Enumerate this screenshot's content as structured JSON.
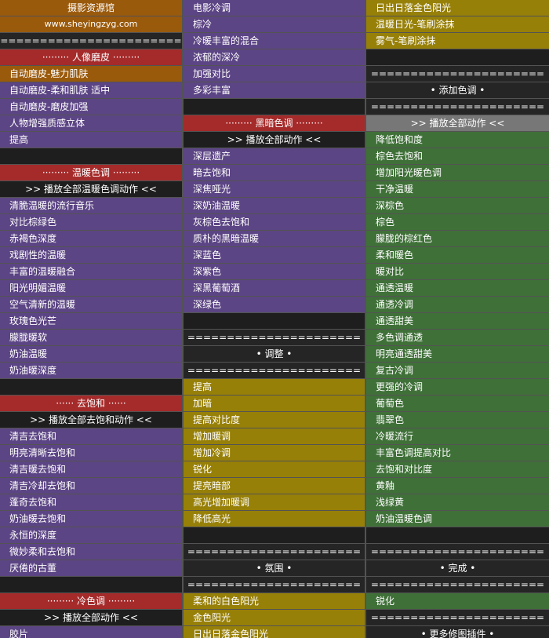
{
  "col1": [
    {
      "text": "摄影资源馆",
      "type": "logo"
    },
    {
      "text": "www.sheyingzyg.com",
      "type": "url"
    },
    {
      "text": "=======================",
      "type": "sep"
    },
    {
      "text": "·········   人像磨皮  ·········",
      "type": "header"
    },
    {
      "text": "自动磨皮-魅力肌肤",
      "type": "orange"
    },
    {
      "text": "自动磨皮-柔和肌肤  适中",
      "type": "purple"
    },
    {
      "text": "自动磨皮-磨皮加强",
      "type": "purple"
    },
    {
      "text": "人物增强质感立体",
      "type": "purple"
    },
    {
      "text": "提高",
      "type": "purple"
    },
    {
      "text": "",
      "type": "black"
    },
    {
      "text": "·········   温暖色调  ·········",
      "type": "header"
    },
    {
      "text": ">> 播放全部温暖色调动作  <<",
      "type": "play"
    },
    {
      "text": "清脆温暖的流行音乐",
      "type": "purple"
    },
    {
      "text": "对比棕绿色",
      "type": "purple"
    },
    {
      "text": "赤褐色深度",
      "type": "purple"
    },
    {
      "text": "戏剧性的温暖",
      "type": "purple"
    },
    {
      "text": "丰富的温暖融合",
      "type": "purple"
    },
    {
      "text": "阳光明媚温暖",
      "type": "purple"
    },
    {
      "text": "空气清新的温暖",
      "type": "purple"
    },
    {
      "text": "玫瑰色光芒",
      "type": "purple"
    },
    {
      "text": "朦胧暖软",
      "type": "purple"
    },
    {
      "text": "奶油温暖",
      "type": "purple"
    },
    {
      "text": "奶油暖深度",
      "type": "purple"
    },
    {
      "text": "",
      "type": "black"
    },
    {
      "text": "······   去饱和   ······",
      "type": "header"
    },
    {
      "text": ">> 播放全部去饱和动作  <<",
      "type": "play"
    },
    {
      "text": "清吉去饱和",
      "type": "purple"
    },
    {
      "text": "明亮清晰去饱和",
      "type": "purple"
    },
    {
      "text": "清吉暖去饱和",
      "type": "purple"
    },
    {
      "text": "清吉冷却去饱和",
      "type": "purple"
    },
    {
      "text": "蓬奇去饱和",
      "type": "purple"
    },
    {
      "text": "奶油暖去饱和",
      "type": "purple"
    },
    {
      "text": "永恒的深度",
      "type": "purple"
    },
    {
      "text": "微妙柔和去饱和",
      "type": "purple"
    },
    {
      "text": "厌倦的古董",
      "type": "purple"
    },
    {
      "text": "",
      "type": "black"
    },
    {
      "text": "·········   冷色调  ·········",
      "type": "header"
    },
    {
      "text": ">> 播放全部动作  <<",
      "type": "play"
    },
    {
      "text": "胶片",
      "type": "purple"
    }
  ],
  "col2": [
    {
      "text": "电影冷调",
      "type": "purple"
    },
    {
      "text": "棕冷",
      "type": "purple"
    },
    {
      "text": "冷暖丰富的混合",
      "type": "purple"
    },
    {
      "text": "浓郁的深冷",
      "type": "purple"
    },
    {
      "text": "加强对比",
      "type": "purple"
    },
    {
      "text": "多彩丰富",
      "type": "purple"
    },
    {
      "text": "",
      "type": "black"
    },
    {
      "text": "·········   黑暗色调  ·········",
      "type": "header"
    },
    {
      "text": ">> 播放全部动作  <<",
      "type": "play"
    },
    {
      "text": "深层遗产",
      "type": "purple"
    },
    {
      "text": "暗去饱和",
      "type": "purple"
    },
    {
      "text": "深焦哑光",
      "type": "purple"
    },
    {
      "text": "深奶油温暖",
      "type": "purple"
    },
    {
      "text": "灰棕色去饱和",
      "type": "purple"
    },
    {
      "text": "质朴的黑暗温暖",
      "type": "purple"
    },
    {
      "text": "深蓝色",
      "type": "purple"
    },
    {
      "text": "深紫色",
      "type": "purple"
    },
    {
      "text": "深黑葡萄酒",
      "type": "purple"
    },
    {
      "text": "深绿色",
      "type": "purple"
    },
    {
      "text": "",
      "type": "black"
    },
    {
      "text": "======================",
      "type": "sep"
    },
    {
      "text": "•  调整  •",
      "type": "sep"
    },
    {
      "text": "======================",
      "type": "sep"
    },
    {
      "text": "提高",
      "type": "gold"
    },
    {
      "text": "加暗",
      "type": "gold"
    },
    {
      "text": "提高对比度",
      "type": "gold"
    },
    {
      "text": "增加暖调",
      "type": "gold"
    },
    {
      "text": "增加冷调",
      "type": "gold"
    },
    {
      "text": "锐化",
      "type": "gold"
    },
    {
      "text": "提亮暗部",
      "type": "gold"
    },
    {
      "text": "高光增加暖调",
      "type": "gold"
    },
    {
      "text": "降低高光",
      "type": "gold"
    },
    {
      "text": "",
      "type": "black"
    },
    {
      "text": "======================",
      "type": "sep"
    },
    {
      "text": "•  氛围  •",
      "type": "sep"
    },
    {
      "text": "======================",
      "type": "sep"
    },
    {
      "text": "柔和的白色阳光",
      "type": "gold"
    },
    {
      "text": "金色阳光",
      "type": "gold"
    },
    {
      "text": "日出日落金色阳光",
      "type": "gold"
    }
  ],
  "col3": [
    {
      "text": "日出日落金色阳光",
      "type": "gold"
    },
    {
      "text": "温暖日光-笔刷涂抹",
      "type": "gold"
    },
    {
      "text": "雾气-笔刷涂抹",
      "type": "gold"
    },
    {
      "text": "",
      "type": "black"
    },
    {
      "text": "======================",
      "type": "sep"
    },
    {
      "text": "•  添加色调  •",
      "type": "sep"
    },
    {
      "text": "======================",
      "type": "sep"
    },
    {
      "text": ">> 播放全部动作  <<",
      "type": "gray"
    },
    {
      "text": "降低饱和度",
      "type": "green"
    },
    {
      "text": "棕色去饱和",
      "type": "green"
    },
    {
      "text": "增加阳光暖色调",
      "type": "green"
    },
    {
      "text": "干净温暖",
      "type": "green"
    },
    {
      "text": "深棕色",
      "type": "green"
    },
    {
      "text": "棕色",
      "type": "green"
    },
    {
      "text": "朦胧的棕红色",
      "type": "green"
    },
    {
      "text": "柔和暖色",
      "type": "green"
    },
    {
      "text": "暖对比",
      "type": "green"
    },
    {
      "text": "通透温暖",
      "type": "green"
    },
    {
      "text": "通透冷调",
      "type": "green"
    },
    {
      "text": "通透甜美",
      "type": "green"
    },
    {
      "text": "多色调通透",
      "type": "green"
    },
    {
      "text": "明亮通透甜美",
      "type": "green"
    },
    {
      "text": "复古冷调",
      "type": "green"
    },
    {
      "text": "更强的冷调",
      "type": "green"
    },
    {
      "text": "葡萄色",
      "type": "green"
    },
    {
      "text": "翡翠色",
      "type": "green"
    },
    {
      "text": "冷暖流行",
      "type": "green"
    },
    {
      "text": "丰富色调提高对比",
      "type": "green"
    },
    {
      "text": "去饱和对比度",
      "type": "green"
    },
    {
      "text": "黄釉",
      "type": "green"
    },
    {
      "text": "浅绿黄",
      "type": "green"
    },
    {
      "text": "奶油温暖色调",
      "type": "green"
    },
    {
      "text": "",
      "type": "black"
    },
    {
      "text": "======================",
      "type": "sep"
    },
    {
      "text": "•  完成  •",
      "type": "sep"
    },
    {
      "text": "======================",
      "type": "sep"
    },
    {
      "text": "锐化",
      "type": "green"
    },
    {
      "text": "======================",
      "type": "sep"
    },
    {
      "text": "•  更多修图插件  •",
      "type": "sep"
    }
  ]
}
